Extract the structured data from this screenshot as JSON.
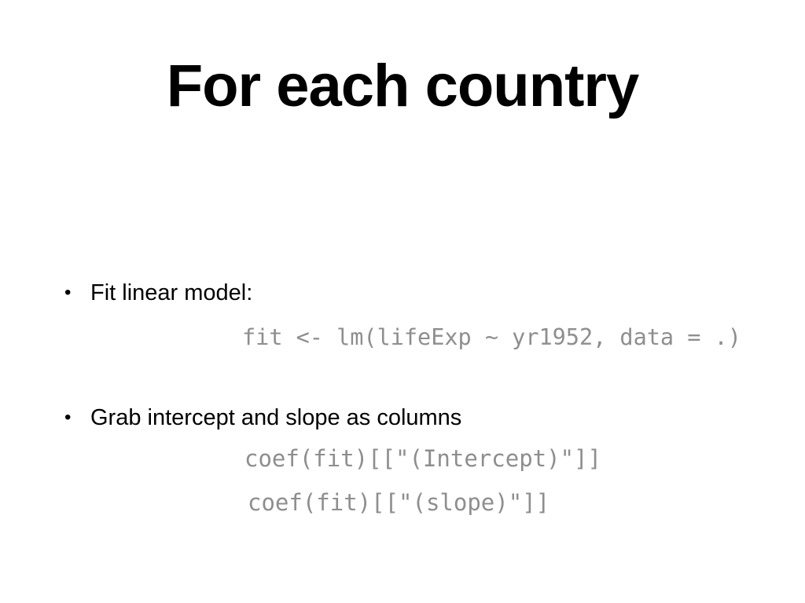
{
  "slide": {
    "title": "For each country",
    "bullets": [
      {
        "marker": "•",
        "text": "Fit linear model:",
        "code": [
          "fit <- lm(lifeExp ~ yr1952, data = .)"
        ]
      },
      {
        "marker": "•",
        "text": "Grab intercept and slope as columns",
        "code": [
          "coef(fit)[[\"(Intercept)\"]]",
          "coef(fit)[[\"(slope)\"]]"
        ]
      }
    ]
  },
  "colors": {
    "background": "#ffffff",
    "text": "#000000",
    "code": "#8e8e8e"
  }
}
